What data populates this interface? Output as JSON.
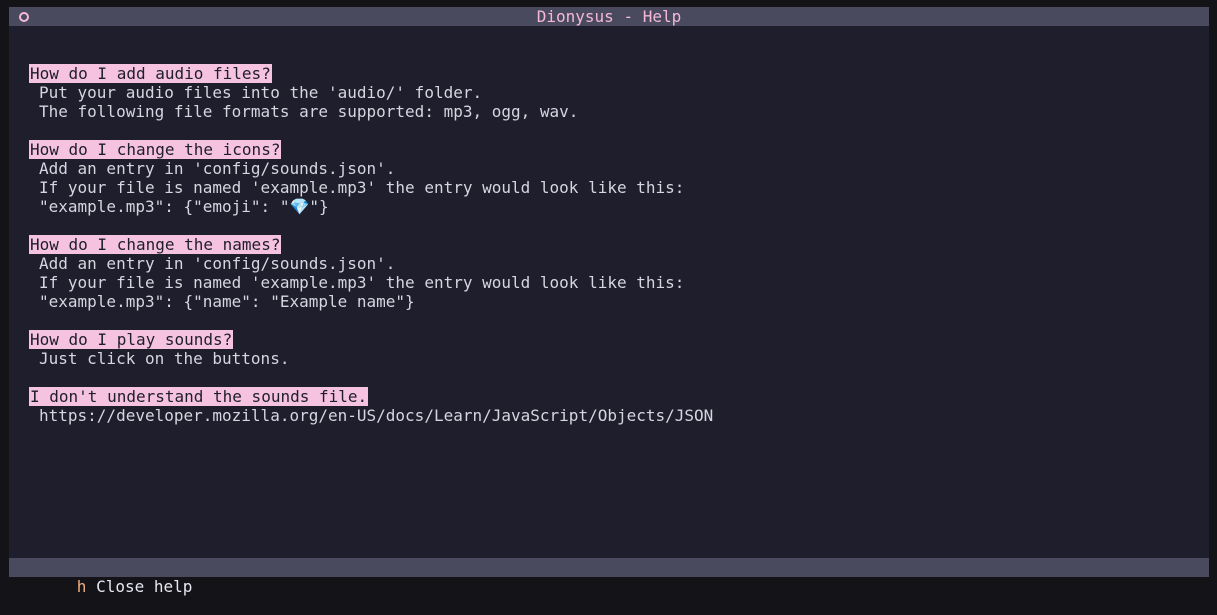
{
  "window": {
    "title": "Dionysus - Help"
  },
  "faq": [
    {
      "question": "How do I add audio files?",
      "answers": [
        "Put your audio files into the 'audio/' folder.",
        "The following file formats are supported: mp3, ogg, wav."
      ]
    },
    {
      "question": "How do I change the icons?",
      "answers": [
        "Add an entry in 'config/sounds.json'.",
        "If your file is named 'example.mp3' the entry would look like this:"
      ],
      "code_prefix": "\"example.mp3\": {\"emoji\": \"",
      "code_emoji": "💎",
      "code_suffix": "\"}"
    },
    {
      "question": "How do I change the names?",
      "answers": [
        "Add an entry in 'config/sounds.json'.",
        "If your file is named 'example.mp3' the entry would look like this:",
        "\"example.mp3\": {\"name\": \"Example name\"}"
      ]
    },
    {
      "question": "How do I play sounds?",
      "answers": [
        "Just click on the buttons."
      ]
    },
    {
      "question": "I don't understand the sounds file.",
      "answers": [
        "https://developer.mozilla.org/en-US/docs/Learn/JavaScript/Objects/JSON"
      ]
    }
  ],
  "statusbar": {
    "key": "h",
    "label": "Close help"
  },
  "colors": {
    "background": "#1e1e2c",
    "bar": "#4a4a5e",
    "question_highlight": "#f5c2e0",
    "title": "#f5b8d8",
    "key": "#f0b080"
  }
}
